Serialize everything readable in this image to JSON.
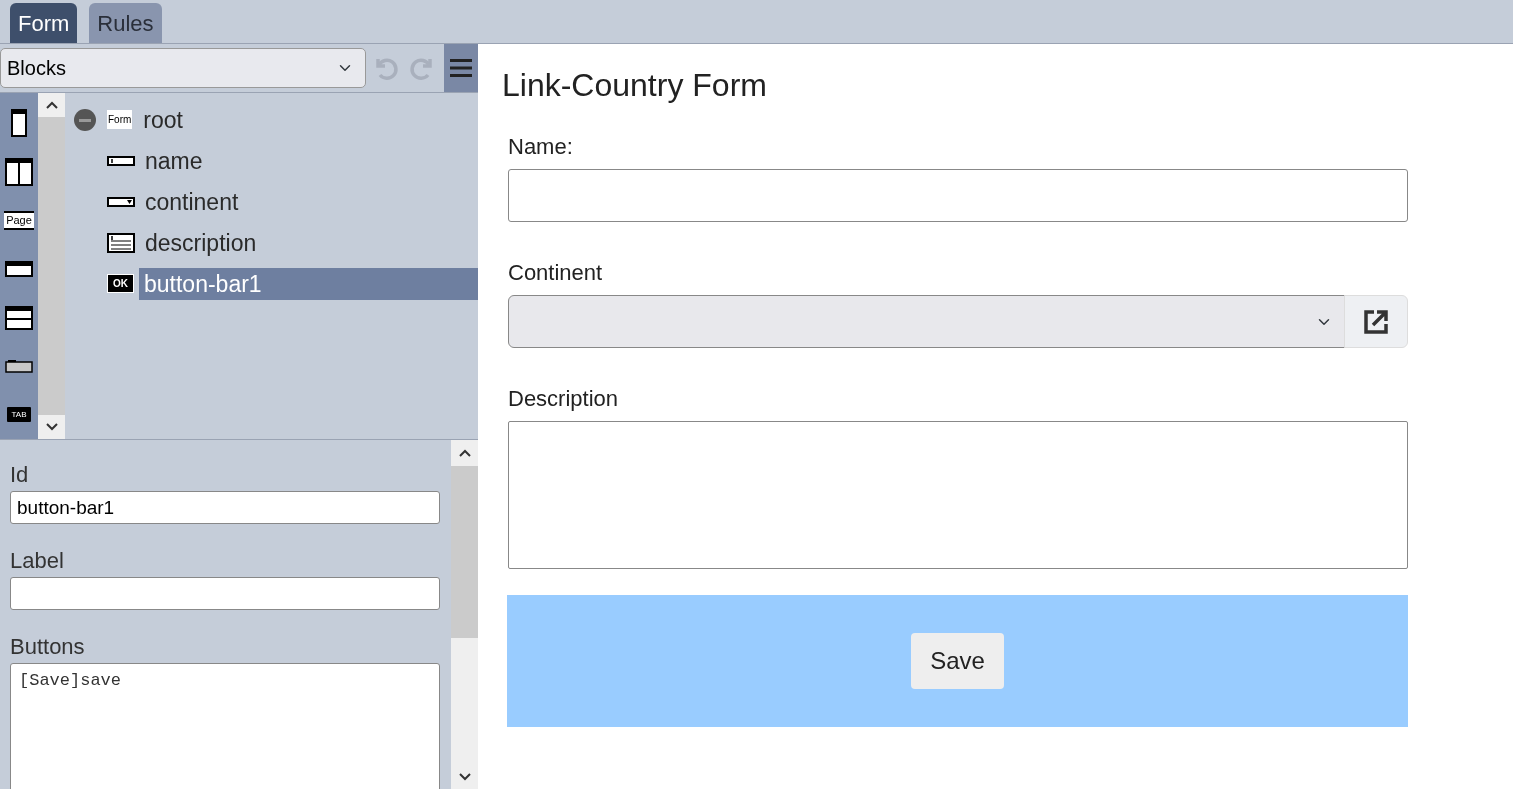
{
  "tabs": [
    {
      "label": "Form",
      "selected": true
    },
    {
      "label": "Rules",
      "selected": false
    }
  ],
  "toolbar": {
    "block_select": {
      "value": "Blocks"
    },
    "undo": {
      "disabled": true
    },
    "redo": {
      "disabled": true
    }
  },
  "palette": [
    {
      "kind": "single"
    },
    {
      "kind": "columns"
    },
    {
      "kind": "page",
      "label": "Page"
    },
    {
      "kind": "bar"
    },
    {
      "kind": "split"
    },
    {
      "kind": "panel"
    },
    {
      "kind": "tab",
      "label": "TAB"
    }
  ],
  "tree": {
    "label": "root",
    "kind": "form",
    "badge": "Form",
    "selected": false,
    "children": [
      {
        "label": "name",
        "kind": "text",
        "selected": false
      },
      {
        "label": "continent",
        "kind": "select",
        "selected": false
      },
      {
        "label": "description",
        "kind": "textarea",
        "selected": false
      },
      {
        "label": "button-bar1",
        "kind": "buttons",
        "badge": "OK",
        "selected": true
      }
    ]
  },
  "properties": [
    {
      "label": "Id",
      "kind": "input",
      "value": "button-bar1"
    },
    {
      "label": "Label",
      "kind": "input"
    },
    {
      "label": "Buttons",
      "kind": "textarea",
      "value": "[Save]save"
    }
  ],
  "preview": {
    "title": "Link-Country Form",
    "fields": [
      {
        "label": "Name:",
        "kind": "text"
      },
      {
        "label": "Continent",
        "kind": "select"
      },
      {
        "label": "Description",
        "kind": "textarea"
      }
    ],
    "buttons": [
      "Save"
    ]
  }
}
